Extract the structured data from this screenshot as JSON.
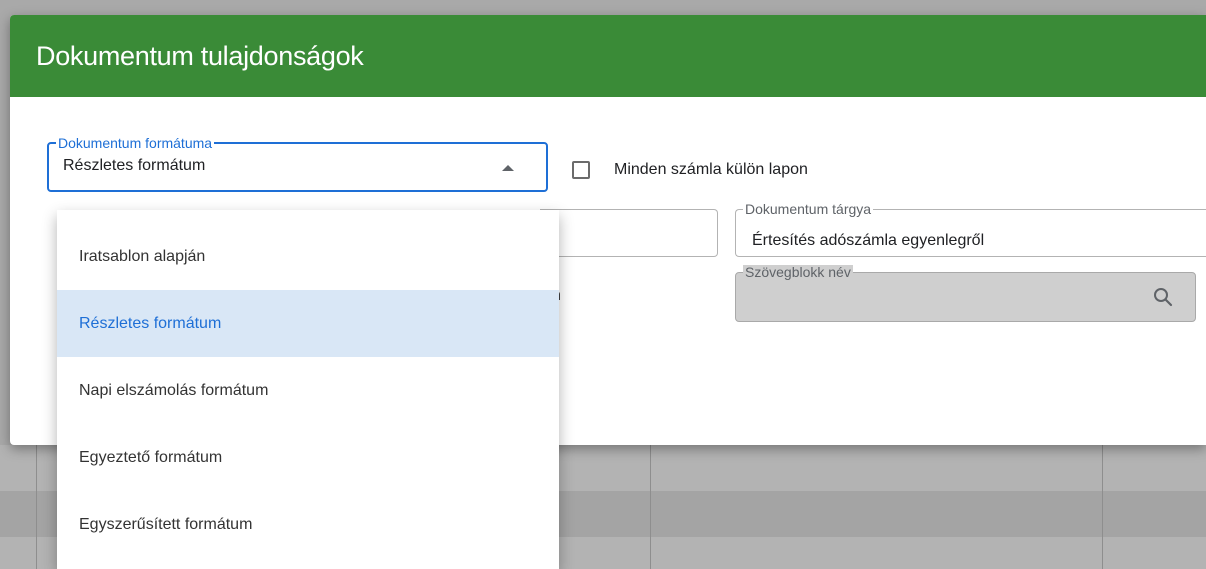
{
  "dialog": {
    "title": "Dokumentum tulajdonságok"
  },
  "format_field": {
    "label": "Dokumentum formátuma",
    "value": "Részletes formátum",
    "caret_icon": "caret-up-icon"
  },
  "checkbox": {
    "label": "Minden számla külön lapon",
    "checked": false
  },
  "subject_field": {
    "label": "Dokumentum tárgya",
    "value": "Értesítés adószámla egyenlegről"
  },
  "text_block_field": {
    "label": "Szövegblokk név",
    "value": "",
    "icon": "search-icon"
  },
  "partial_text": "n",
  "dropdown": {
    "options": [
      {
        "label": "Iratsablon alapján",
        "selected": false
      },
      {
        "label": "Részletes formátum",
        "selected": true
      },
      {
        "label": "Napi elszámolás formátum",
        "selected": false
      },
      {
        "label": "Egyeztető formátum",
        "selected": false
      },
      {
        "label": "Egyszerűsített formátum",
        "selected": false
      }
    ]
  },
  "colors": {
    "header": "#3a8b37",
    "accent": "#1e6fd6",
    "selected_bg": "#d9e7f6",
    "backdrop": "#a9a9a9"
  }
}
